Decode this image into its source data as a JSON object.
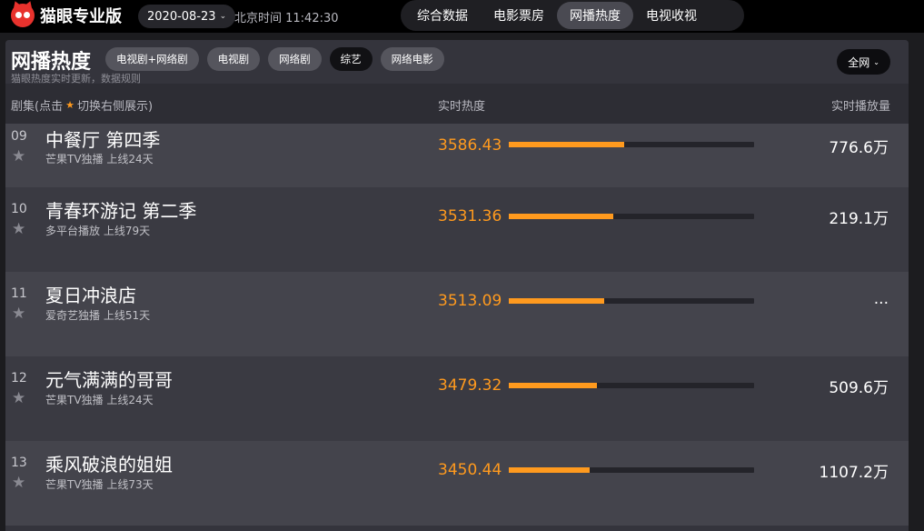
{
  "app": {
    "logo_text": "猫眼专业版"
  },
  "header": {
    "date": "2020-08-23",
    "beijing_time": "北京时间 11:42:30",
    "nav_tabs": [
      {
        "label": "综合数据",
        "active": false
      },
      {
        "label": "电影票房",
        "active": false
      },
      {
        "label": "网播热度",
        "active": true
      },
      {
        "label": "电视收视",
        "active": false
      }
    ]
  },
  "panel": {
    "title": "网播热度",
    "subtitle": "猫眼热度实时更新，数据规则",
    "filters": [
      {
        "label": "电视剧+网络剧",
        "active": false
      },
      {
        "label": "电视剧",
        "active": false
      },
      {
        "label": "网络剧",
        "active": false
      },
      {
        "label": "综艺",
        "active": true
      },
      {
        "label": "网络电影",
        "active": false
      }
    ],
    "scope": "全网"
  },
  "columns": {
    "title_prefix": "剧集(点击",
    "title_suffix": "切换右侧展示)",
    "heat": "实时热度",
    "plays": "实时播放量"
  },
  "rows": [
    {
      "rank": "09",
      "name": "中餐厅 第四季",
      "meta": "芒果TV独播  上线24天",
      "heat": "3586.43",
      "heat_fraction": 0.47,
      "plays": "776.6万"
    },
    {
      "rank": "10",
      "name": "青春环游记 第二季",
      "meta": "多平台播放  上线79天",
      "heat": "3531.36",
      "heat_fraction": 0.425,
      "plays": "219.1万"
    },
    {
      "rank": "11",
      "name": "夏日冲浪店",
      "meta": "爱奇艺独播  上线51天",
      "heat": "3513.09",
      "heat_fraction": 0.39,
      "plays": "..."
    },
    {
      "rank": "12",
      "name": "元气满满的哥哥",
      "meta": "芒果TV独播  上线24天",
      "heat": "3479.32",
      "heat_fraction": 0.36,
      "plays": "509.6万"
    },
    {
      "rank": "13",
      "name": "乘风破浪的姐姐",
      "meta": "芒果TV独播  上线73天",
      "heat": "3450.44",
      "heat_fraction": 0.33,
      "plays": "1107.2万"
    }
  ],
  "colors": {
    "accent": "#ff9a1e",
    "logo": "#e8322d"
  }
}
